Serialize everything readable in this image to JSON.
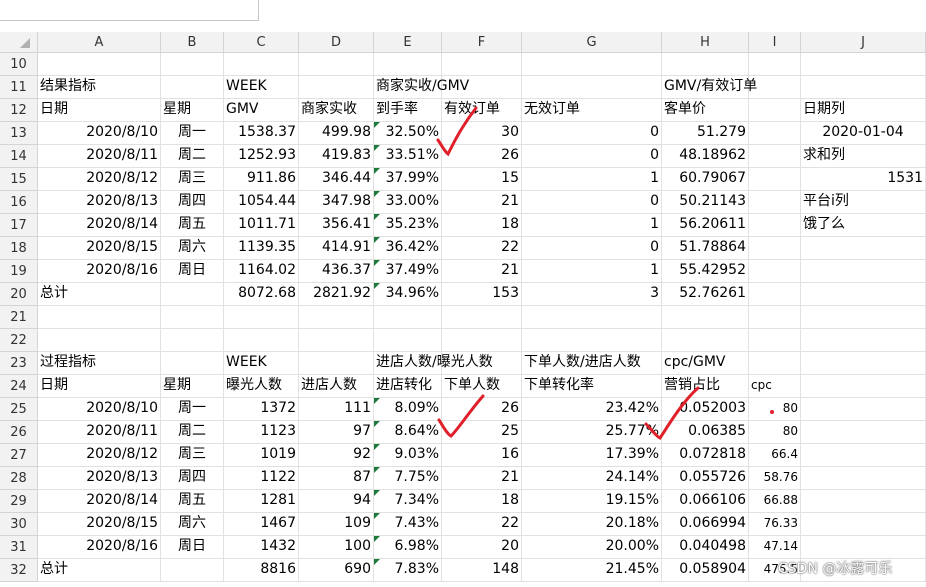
{
  "columns": [
    "A",
    "B",
    "C",
    "D",
    "E",
    "F",
    "G",
    "H",
    "I",
    "J"
  ],
  "rows": [
    {
      "n": "10",
      "cells": {}
    },
    {
      "n": "11",
      "cells": {
        "A": "结果指标",
        "C": "WEEK",
        "E": "商家实收/GMV",
        "H": "GMV/有效订单"
      }
    },
    {
      "n": "12",
      "cells": {
        "A": "日期",
        "B": "星期",
        "C": "GMV",
        "D": "商家实收",
        "E": "到手率",
        "F": "有效订单",
        "G": "无效订单",
        "H": "客单价",
        "J": "日期列"
      }
    },
    {
      "n": "13",
      "cells": {
        "A": "2020/8/10",
        "B": "周一",
        "C": "1538.37",
        "D": "499.98",
        "E": "32.50%",
        "F": "30",
        "G": "0",
        "H": "51.279",
        "J": "2020-01-04"
      }
    },
    {
      "n": "14",
      "cells": {
        "A": "2020/8/11",
        "B": "周二",
        "C": "1252.93",
        "D": "419.83",
        "E": "33.51%",
        "F": "26",
        "G": "0",
        "H": "48.18962",
        "J": "求和列"
      }
    },
    {
      "n": "15",
      "cells": {
        "A": "2020/8/12",
        "B": "周三",
        "C": "911.86",
        "D": "346.44",
        "E": "37.99%",
        "F": "15",
        "G": "1",
        "H": "60.79067",
        "J": "1531"
      }
    },
    {
      "n": "16",
      "cells": {
        "A": "2020/8/13",
        "B": "周四",
        "C": "1054.44",
        "D": "347.98",
        "E": "33.00%",
        "F": "21",
        "G": "0",
        "H": "50.21143",
        "J": "平台i列"
      }
    },
    {
      "n": "17",
      "cells": {
        "A": "2020/8/14",
        "B": "周五",
        "C": "1011.71",
        "D": "356.41",
        "E": "35.23%",
        "F": "18",
        "G": "1",
        "H": "56.20611",
        "J": "饿了么"
      }
    },
    {
      "n": "18",
      "cells": {
        "A": "2020/8/15",
        "B": "周六",
        "C": "1139.35",
        "D": "414.91",
        "E": "36.42%",
        "F": "22",
        "G": "0",
        "H": "51.78864"
      }
    },
    {
      "n": "19",
      "cells": {
        "A": "2020/8/16",
        "B": "周日",
        "C": "1164.02",
        "D": "436.37",
        "E": "37.49%",
        "F": "21",
        "G": "1",
        "H": "55.42952"
      }
    },
    {
      "n": "20",
      "cells": {
        "A": "总计",
        "C": "8072.68",
        "D": "2821.92",
        "E": "34.96%",
        "F": "153",
        "G": "3",
        "H": "52.76261"
      }
    },
    {
      "n": "21",
      "cells": {}
    },
    {
      "n": "22",
      "cells": {}
    },
    {
      "n": "23",
      "cells": {
        "A": "过程指标",
        "C": "WEEK",
        "E": "进店人数/曝光人数",
        "G": "下单人数/进店人数",
        "H": "cpc/GMV"
      }
    },
    {
      "n": "24",
      "cells": {
        "A": "日期",
        "B": "星期",
        "C": "曝光人数",
        "D": "进店人数",
        "E": "进店转化",
        "F": "下单人数",
        "G": "下单转化率",
        "H": "营销占比",
        "I": "cpc"
      }
    },
    {
      "n": "25",
      "cells": {
        "A": "2020/8/10",
        "B": "周一",
        "C": "1372",
        "D": "111",
        "E": "8.09%",
        "F": "26",
        "G": "23.42%",
        "H": "0.052003",
        "I": "80"
      }
    },
    {
      "n": "26",
      "cells": {
        "A": "2020/8/11",
        "B": "周二",
        "C": "1123",
        "D": "97",
        "E": "8.64%",
        "F": "25",
        "G": "25.77%",
        "H": "0.06385",
        "I": "80"
      }
    },
    {
      "n": "27",
      "cells": {
        "A": "2020/8/12",
        "B": "周三",
        "C": "1019",
        "D": "92",
        "E": "9.03%",
        "F": "16",
        "G": "17.39%",
        "H": "0.072818",
        "I": "66.4"
      }
    },
    {
      "n": "28",
      "cells": {
        "A": "2020/8/13",
        "B": "周四",
        "C": "1122",
        "D": "87",
        "E": "7.75%",
        "F": "21",
        "G": "24.14%",
        "H": "0.055726",
        "I": "58.76"
      }
    },
    {
      "n": "29",
      "cells": {
        "A": "2020/8/14",
        "B": "周五",
        "C": "1281",
        "D": "94",
        "E": "7.34%",
        "F": "18",
        "G": "19.15%",
        "H": "0.066106",
        "I": "66.88"
      }
    },
    {
      "n": "30",
      "cells": {
        "A": "2020/8/15",
        "B": "周六",
        "C": "1467",
        "D": "109",
        "E": "7.43%",
        "F": "22",
        "G": "20.18%",
        "H": "0.066994",
        "I": "76.33"
      }
    },
    {
      "n": "31",
      "cells": {
        "A": "2020/8/16",
        "B": "周日",
        "C": "1432",
        "D": "100",
        "E": "6.98%",
        "F": "20",
        "G": "20.00%",
        "H": "0.040498",
        "I": "47.14"
      }
    },
    {
      "n": "32",
      "cells": {
        "A": "总计",
        "C": "8816",
        "D": "690",
        "E": "7.83%",
        "F": "148",
        "G": "21.45%",
        "H": "0.058904",
        "I": "475.5"
      }
    }
  ],
  "watermark": "CSDN @冰露可乐",
  "colors": {
    "error_indicator": "#1e7a3c",
    "annotation": "#e0202a",
    "header_bg": "#f2f2f2",
    "gridline": "#e1e1e1"
  },
  "icons": {
    "select_all": "select-all-triangle-icon",
    "cell_error": "number-as-text-indicator-icon",
    "annotation": "red-checkmark-icon"
  }
}
